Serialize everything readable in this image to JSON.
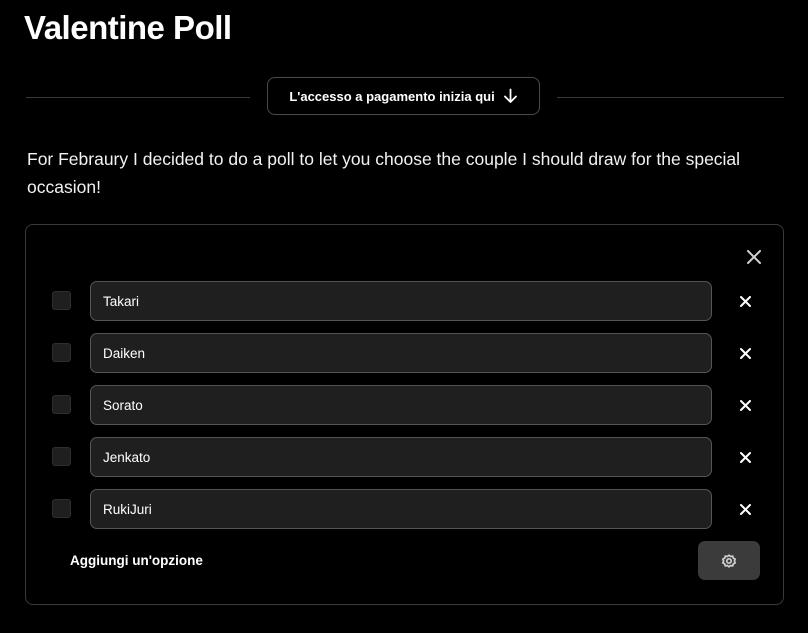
{
  "post": {
    "title": "Valentine Poll",
    "paywall_button_label": "L'accesso a pagamento inizia qui",
    "body_text": "For Febraury I decided to do a poll to let you choose the couple I should draw for the special occasion!"
  },
  "poll": {
    "options": [
      {
        "value": "Takari"
      },
      {
        "value": "Daiken"
      },
      {
        "value": "Sorato"
      },
      {
        "value": "Jenkato"
      },
      {
        "value": "RukiJuri"
      }
    ],
    "add_option_label": "Aggiungi un'opzione"
  },
  "icons": {
    "paywall": "arrow-down-icon",
    "poll_close": "close-icon",
    "option_remove": "close-icon",
    "settings": "gear-icon"
  },
  "colors": {
    "background": "#000000",
    "input_background": "#1e1f1e",
    "border": "#3a3a3a",
    "settings_button": "#3b3b3b",
    "text": "#ffffff"
  }
}
